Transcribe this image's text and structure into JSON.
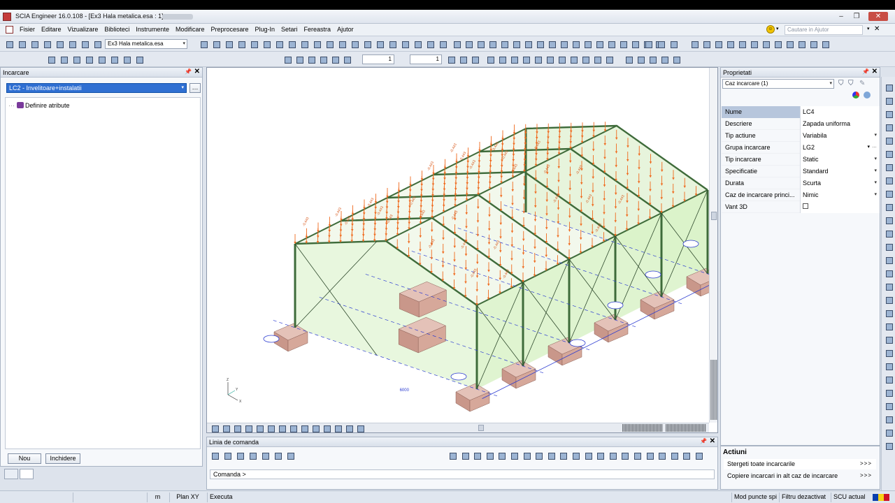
{
  "titlebar": {
    "title": "SCIA Engineer 16.0.108 - [Ex3 Hala metalica.esa : 1]"
  },
  "menu": {
    "items": [
      "Fisier",
      "Editare",
      "Vizualizare",
      "Biblioteci",
      "Instrumente",
      "Modificare",
      "Preprocesare",
      "Plug-In",
      "Setari",
      "Fereastra",
      "Ajutor"
    ]
  },
  "help": {
    "placeholder": "Cautare in Ajutor"
  },
  "toolbar": {
    "project_combo": "Ex3 Hala metalica.esa",
    "spin1": "1",
    "spin2": "1"
  },
  "left_panel": {
    "title": "Incarcare",
    "combo": "LC2 - Invelitoare+instalatii",
    "tree_item": "Definire atribute",
    "btn_new": "Nou",
    "btn_close": "Inchidere"
  },
  "viewport": {
    "dimension_label": "6000",
    "load_label": "-0.443",
    "axis_z": "Z",
    "axis_y": "Y",
    "axis_x": "X"
  },
  "command": {
    "title": "Linia de comanda",
    "prompt": "Comanda >"
  },
  "properties": {
    "title": "Proprietati",
    "combo": "Caz incarcare (1)",
    "rows": [
      {
        "key": "Nume",
        "value": "LC4",
        "dropdown": false,
        "selected": true
      },
      {
        "key": "Descriere",
        "value": "Zapada uniforma",
        "dropdown": false,
        "selected": false
      },
      {
        "key": "Tip actiune",
        "value": "Variabila",
        "dropdown": true,
        "selected": false
      },
      {
        "key": "Grupa incarcare",
        "value": "LG2",
        "dropdown": true,
        "selected": false
      },
      {
        "key": "Tip incarcare",
        "value": "Static",
        "dropdown": true,
        "selected": false
      },
      {
        "key": "Specificatie",
        "value": "Standard",
        "dropdown": true,
        "selected": false
      },
      {
        "key": "Durata",
        "value": "Scurta",
        "dropdown": true,
        "selected": false
      },
      {
        "key": "Caz de incarcare princi...",
        "value": "Nimic",
        "dropdown": true,
        "selected": false
      },
      {
        "key": "Vant 3D",
        "value": "",
        "dropdown": false,
        "selected": false
      }
    ],
    "actions_title": "Actiuni",
    "actions": [
      {
        "label": "Stergeti toate incarcarile",
        "go": ">>>"
      },
      {
        "label": "Copiere incarcari in alt caz de incarcare",
        "go": ">>>"
      }
    ]
  },
  "statusbar": {
    "unit": "m",
    "plan": "Plan XY",
    "status": "Executa",
    "snap": "Mod puncte spi",
    "filter": "Filtru dezactivat",
    "ucs": "SCU actual"
  },
  "colors": {
    "load_arrows": "#f06a1e",
    "steel": "#3e6b3a",
    "panels": "#d9f2c8",
    "foundation": "#d6a89a",
    "selection": "#2f6fd2"
  }
}
